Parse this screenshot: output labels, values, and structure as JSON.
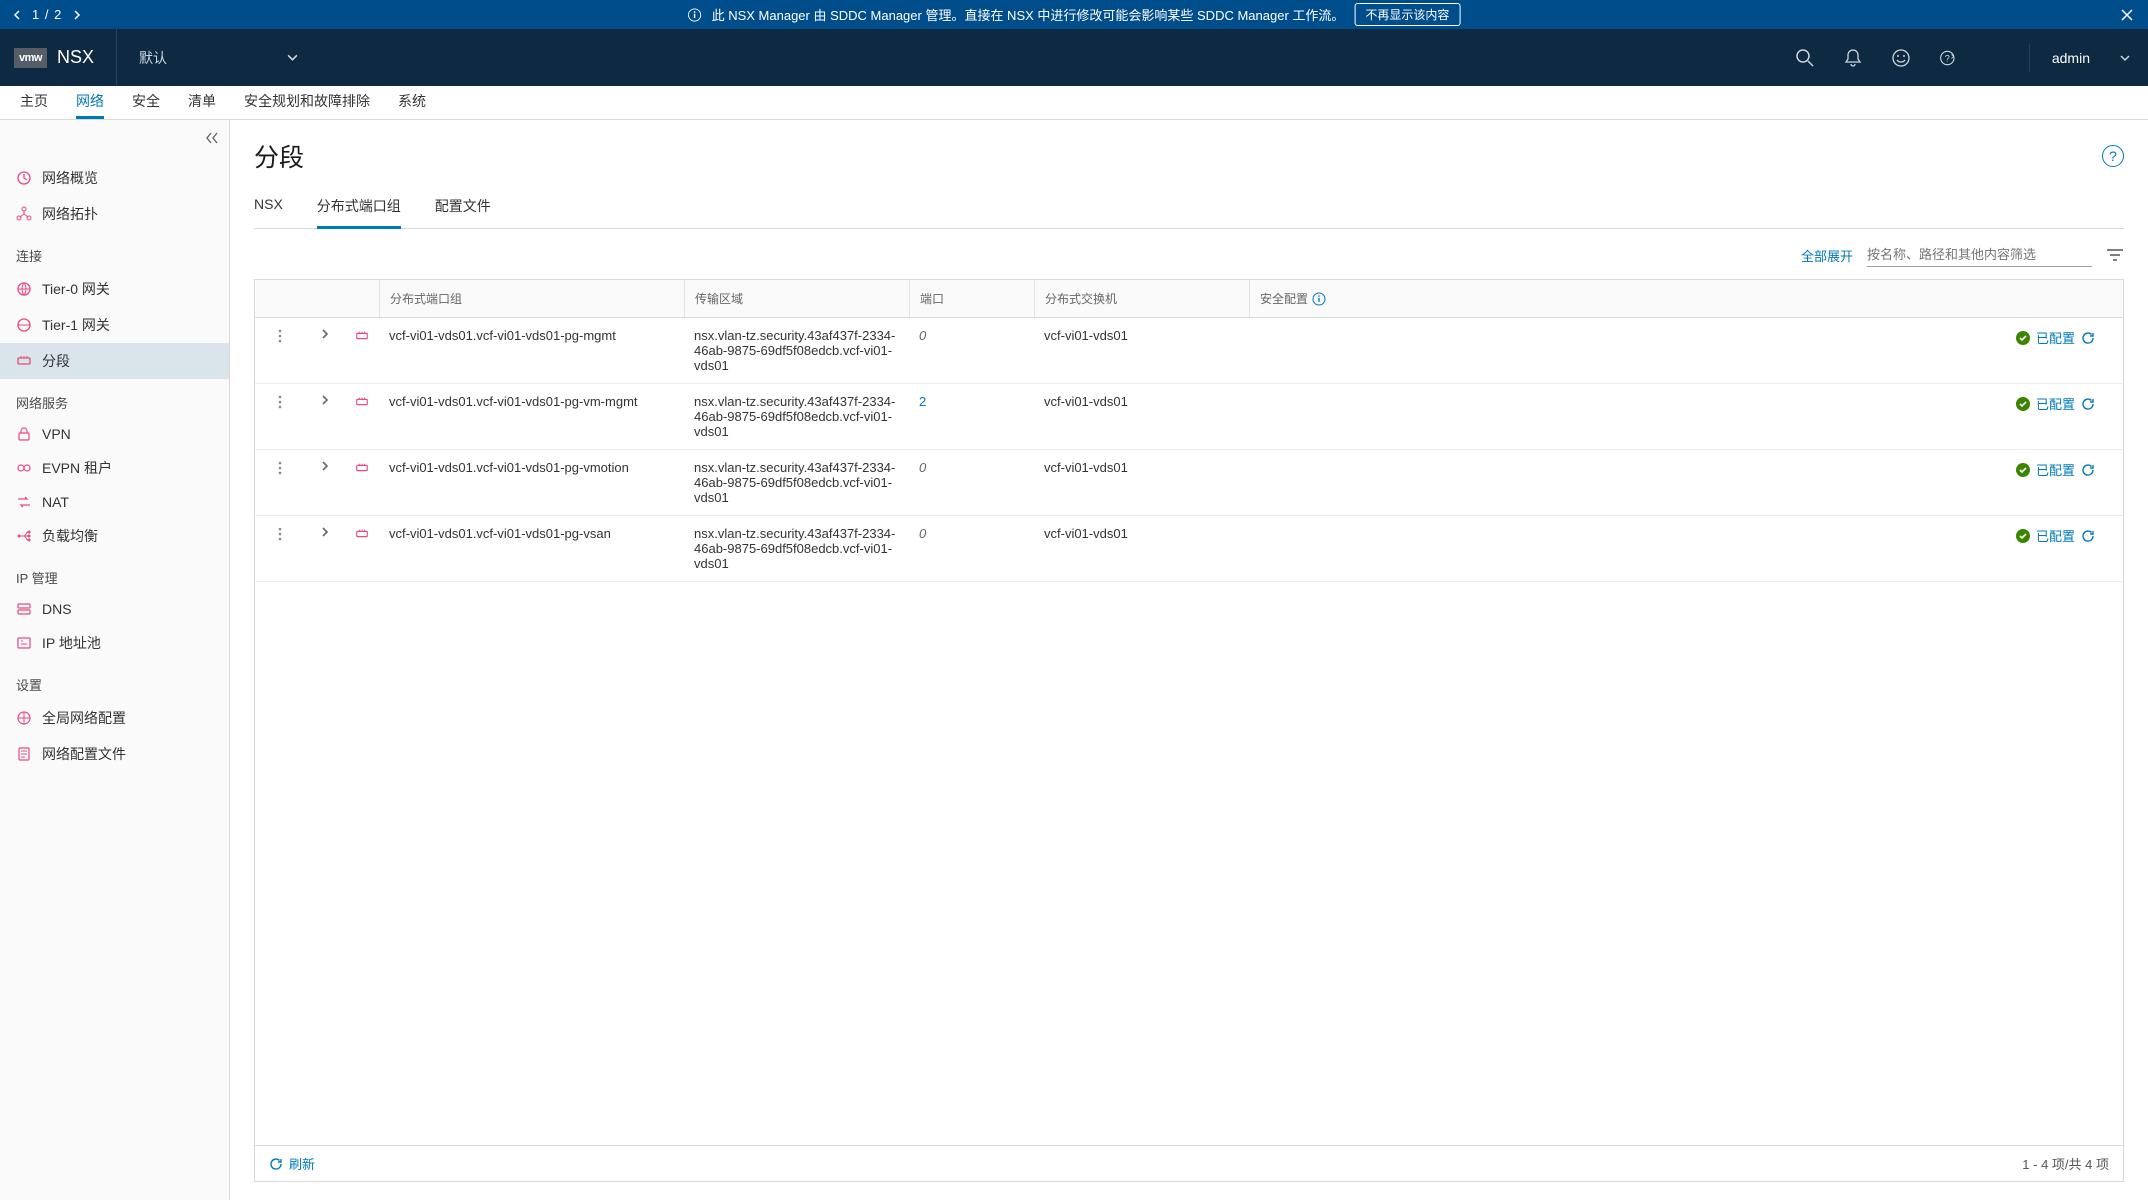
{
  "banner": {
    "position": "1 / 2",
    "message": "此 NSX Manager 由 SDDC Manager 管理。直接在 NSX 中进行修改可能会影响某些 SDDC Manager 工作流。",
    "dismiss_label": "不再显示该内容"
  },
  "header": {
    "logo": "vmw",
    "product": "NSX",
    "context": "默认",
    "user": "admin"
  },
  "tabs": [
    "主页",
    "网络",
    "安全",
    "清单",
    "安全规划和故障排除",
    "系统"
  ],
  "active_tab": 1,
  "sidebar": {
    "top": [
      {
        "icon": "overview",
        "label": "网络概览"
      },
      {
        "icon": "topology",
        "label": "网络拓扑"
      }
    ],
    "groups": [
      {
        "title": "连接",
        "items": [
          {
            "icon": "gateway",
            "label": "Tier-0 网关"
          },
          {
            "icon": "gateway",
            "label": "Tier-1 网关"
          },
          {
            "icon": "segment",
            "label": "分段",
            "active": true
          }
        ]
      },
      {
        "title": "网络服务",
        "items": [
          {
            "icon": "vpn",
            "label": "VPN"
          },
          {
            "icon": "evpn",
            "label": "EVPN 租户"
          },
          {
            "icon": "nat",
            "label": "NAT"
          },
          {
            "icon": "lb",
            "label": "负载均衡"
          }
        ]
      },
      {
        "title": "IP 管理",
        "items": [
          {
            "icon": "dns",
            "label": "DNS"
          },
          {
            "icon": "ippool",
            "label": "IP 地址池"
          }
        ]
      },
      {
        "title": "设置",
        "items": [
          {
            "icon": "global",
            "label": "全局网络配置"
          },
          {
            "icon": "profile",
            "label": "网络配置文件"
          }
        ]
      }
    ]
  },
  "page": {
    "title": "分段",
    "subtabs": [
      "NSX",
      "分布式端口组",
      "配置文件"
    ],
    "active_subtab": 1,
    "expand_all": "全部展开",
    "filter_placeholder": "按名称、路径和其他内容筛选"
  },
  "table": {
    "headers": {
      "name": "分布式端口组",
      "zone": "传输区域",
      "port": "端口",
      "switch": "分布式交换机",
      "security": "安全配置"
    },
    "rows": [
      {
        "name": "vcf-vi01-vds01.vcf-vi01-vds01-pg-mgmt",
        "zone": "nsx.vlan-tz.security.43af437f-2334-46ab-9875-69df5f08edcb.vcf-vi01-vds01",
        "port": "0",
        "port_link": false,
        "switch": "vcf-vi01-vds01",
        "security": "已配置"
      },
      {
        "name": "vcf-vi01-vds01.vcf-vi01-vds01-pg-vm-mgmt",
        "zone": "nsx.vlan-tz.security.43af437f-2334-46ab-9875-69df5f08edcb.vcf-vi01-vds01",
        "port": "2",
        "port_link": true,
        "switch": "vcf-vi01-vds01",
        "security": "已配置"
      },
      {
        "name": "vcf-vi01-vds01.vcf-vi01-vds01-pg-vmotion",
        "zone": "nsx.vlan-tz.security.43af437f-2334-46ab-9875-69df5f08edcb.vcf-vi01-vds01",
        "port": "0",
        "port_link": false,
        "switch": "vcf-vi01-vds01",
        "security": "已配置"
      },
      {
        "name": "vcf-vi01-vds01.vcf-vi01-vds01-pg-vsan",
        "zone": "nsx.vlan-tz.security.43af437f-2334-46ab-9875-69df5f08edcb.vcf-vi01-vds01",
        "port": "0",
        "port_link": false,
        "switch": "vcf-vi01-vds01",
        "security": "已配置"
      }
    ],
    "footer": {
      "refresh": "刷新",
      "count": "1 - 4 项/共 4 项"
    }
  }
}
